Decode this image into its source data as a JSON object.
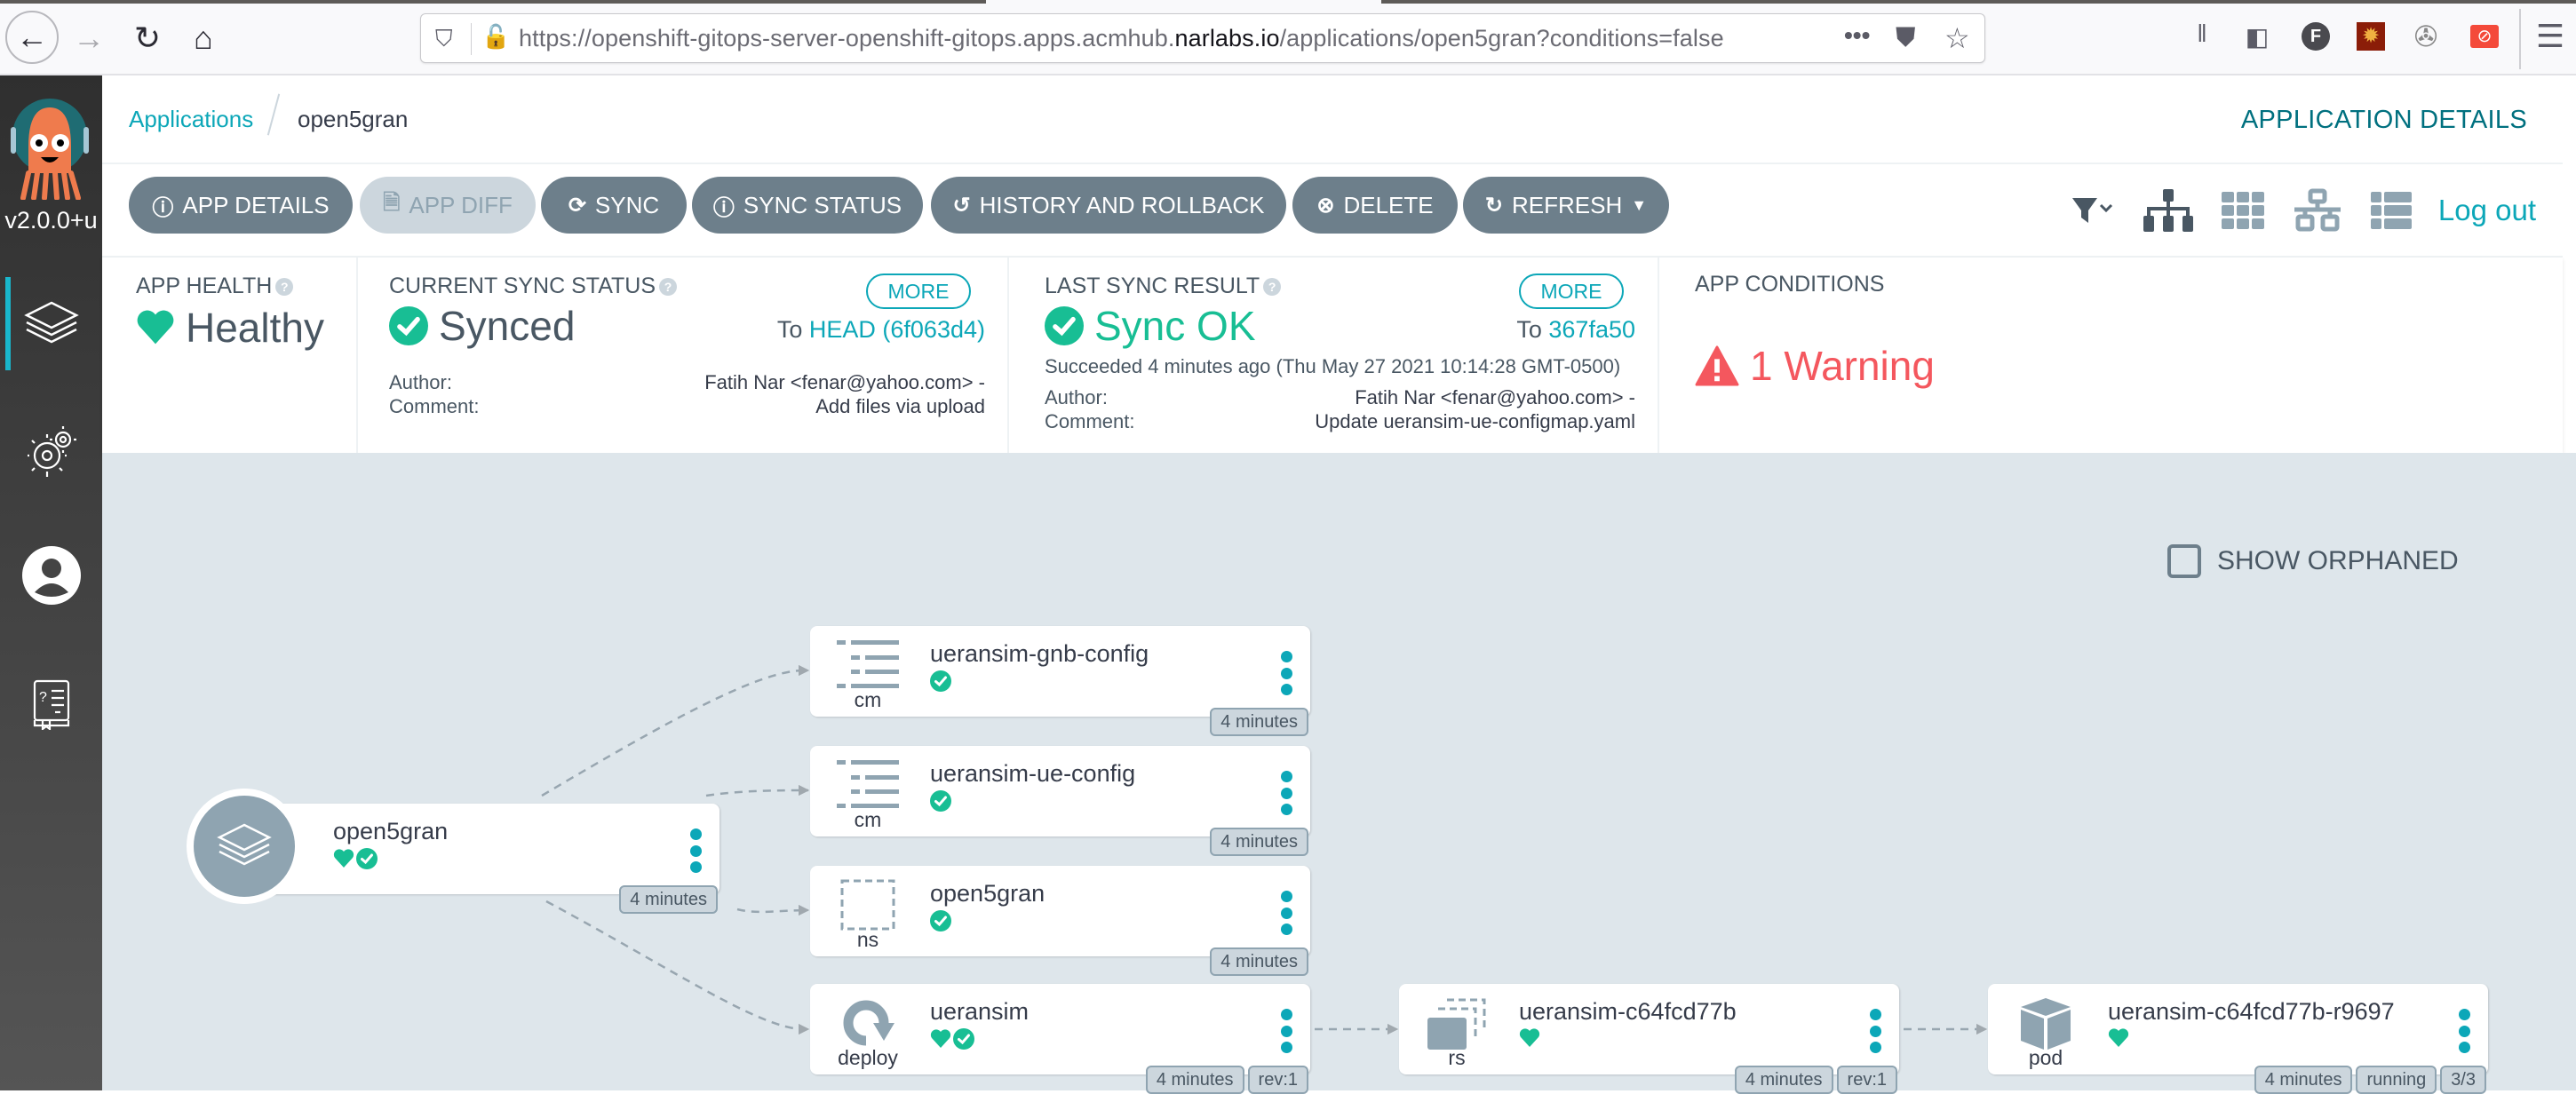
{
  "browser": {
    "url_prefix": "https://openshift-gitops-server-openshift-gitops.apps.acmhub.",
    "url_domain": "narlabs.io",
    "url_suffix": "/applications/open5gran?conditions=false",
    "more_label": "•••"
  },
  "sidebar": {
    "version": "v2.0.0+u",
    "items": [
      {
        "name": "applications",
        "icon": "layers-icon",
        "active": true
      },
      {
        "name": "settings",
        "icon": "gears-icon",
        "active": false
      },
      {
        "name": "user-info",
        "icon": "user-icon",
        "active": false
      },
      {
        "name": "docs",
        "icon": "help-book-icon",
        "active": false
      }
    ]
  },
  "breadcrumb": {
    "root": "Applications",
    "current": "open5gran"
  },
  "header": {
    "title": "APPLICATION DETAILS"
  },
  "toolbar": {
    "buttons": [
      {
        "label": "APP DETAILS",
        "icon": "info-icon",
        "disabled": false
      },
      {
        "label": "APP DIFF",
        "icon": "file-diff-icon",
        "disabled": true
      },
      {
        "label": "SYNC",
        "icon": "sync-icon",
        "disabled": false
      },
      {
        "label": "SYNC STATUS",
        "icon": "info-icon",
        "disabled": false
      },
      {
        "label": "HISTORY AND ROLLBACK",
        "icon": "history-icon",
        "disabled": false
      },
      {
        "label": "DELETE",
        "icon": "delete-icon",
        "disabled": false
      },
      {
        "label": "REFRESH",
        "icon": "refresh-icon",
        "disabled": false,
        "dropdown": true
      }
    ],
    "logout": "Log out"
  },
  "status": {
    "health": {
      "label": "APP HEALTH",
      "value": "Healthy"
    },
    "sync": {
      "label": "CURRENT SYNC STATUS",
      "more": "MORE",
      "value": "Synced",
      "to_prefix": "To",
      "revision": "HEAD (6f063d4)",
      "author_label": "Author:",
      "author": "Fatih Nar <fenar@yahoo.com> -",
      "comment_label": "Comment:",
      "comment": "Add files via upload"
    },
    "last_sync": {
      "label": "LAST SYNC RESULT",
      "more": "MORE",
      "value": "Sync OK",
      "to_prefix": "To",
      "revision": "367fa50",
      "succeeded": "Succeeded 4 minutes ago (Thu May 27 2021 10:14:28 GMT-0500)",
      "author_label": "Author:",
      "author": "Fatih Nar <fenar@yahoo.com> -",
      "comment_label": "Comment:",
      "comment": "Update ueransim-ue-configmap.yaml"
    },
    "conditions": {
      "label": "APP CONDITIONS",
      "value": "1 Warning"
    }
  },
  "graph": {
    "show_orphaned": "SHOW ORPHANED",
    "show_orphaned_checked": false,
    "app_node": {
      "name": "open5gran",
      "healthy": true,
      "synced": true,
      "tags": [
        "4 minutes"
      ]
    },
    "nodes": [
      {
        "id": "cm1",
        "kind": "cm",
        "name": "ueransim-gnb-config",
        "healthy": false,
        "synced": true,
        "tags": [
          "4 minutes"
        ]
      },
      {
        "id": "cm2",
        "kind": "cm",
        "name": "ueransim-ue-config",
        "healthy": false,
        "synced": true,
        "tags": [
          "4 minutes"
        ]
      },
      {
        "id": "ns",
        "kind": "ns",
        "name": "open5gran",
        "healthy": false,
        "synced": true,
        "tags": [
          "4 minutes"
        ]
      },
      {
        "id": "deploy",
        "kind": "deploy",
        "name": "ueransim",
        "healthy": true,
        "synced": true,
        "tags": [
          "4 minutes",
          "rev:1"
        ]
      },
      {
        "id": "rs",
        "kind": "rs",
        "name": "ueransim-c64fcd77b",
        "healthy": true,
        "synced": false,
        "tags": [
          "4 minutes",
          "rev:1"
        ]
      },
      {
        "id": "pod",
        "kind": "pod",
        "name": "ueransim-c64fcd77b-r9697",
        "healthy": true,
        "synced": false,
        "tags": [
          "4 minutes",
          "running",
          "3/3"
        ]
      }
    ]
  },
  "colors": {
    "accent": "#0ca7b8",
    "healthy": "#18be94",
    "warning": "#f4575e",
    "button": "#6d7f8b",
    "button_disabled": "#ccd6dd",
    "graph_bg": "#dee6eb"
  }
}
